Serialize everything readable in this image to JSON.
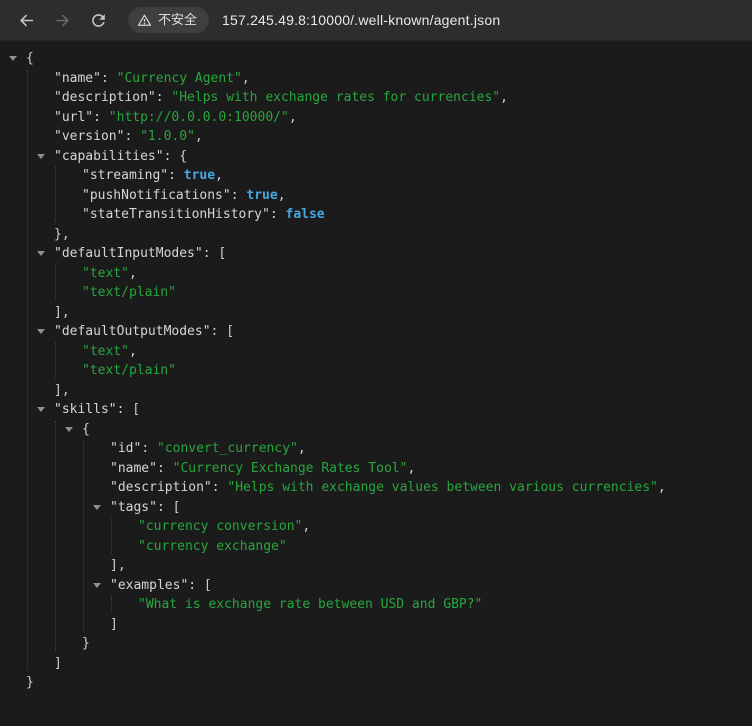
{
  "browser": {
    "security_chip": {
      "label": "不安全",
      "icon": "warning-triangle-icon"
    },
    "url": "157.245.49.8:10000/.well-known/agent.json",
    "icons": {
      "back": "arrow-left",
      "forward": "arrow-right",
      "reload": "refresh"
    }
  },
  "colors": {
    "key": "#d5d5d5",
    "string": "#28a63e",
    "boolean": "#44a7e2",
    "punctuation": "#cfcfcf",
    "guide": "#414141",
    "toolbar_bg": "#2d2d2d",
    "content_bg": "#1b1b1b",
    "chip_bg": "#3f3f3f",
    "icon": "#c6c6c6",
    "icon_disabled": "#696969",
    "url_text": "#e9e9e9",
    "chip_text": "#dedede",
    "triangle": "#8f8f8f"
  },
  "json_viewer": {
    "lines": [
      {
        "level": 0,
        "tri": true,
        "open": true,
        "segs": [
          [
            "p",
            "{"
          ]
        ]
      },
      {
        "level": 1,
        "segs": [
          [
            "k",
            "\"name\""
          ],
          [
            "p",
            ": "
          ],
          [
            "s",
            "\"Currency Agent\""
          ],
          [
            "p",
            ","
          ]
        ]
      },
      {
        "level": 1,
        "segs": [
          [
            "k",
            "\"description\""
          ],
          [
            "p",
            ": "
          ],
          [
            "s",
            "\"Helps with exchange rates for currencies\""
          ],
          [
            "p",
            ","
          ]
        ]
      },
      {
        "level": 1,
        "segs": [
          [
            "k",
            "\"url\""
          ],
          [
            "p",
            ": "
          ],
          [
            "s",
            "\"http://0.0.0.0:10000/\""
          ],
          [
            "p",
            ","
          ]
        ]
      },
      {
        "level": 1,
        "segs": [
          [
            "k",
            "\"version\""
          ],
          [
            "p",
            ": "
          ],
          [
            "s",
            "\"1.0.0\""
          ],
          [
            "p",
            ","
          ]
        ]
      },
      {
        "level": 1,
        "tri": true,
        "open": true,
        "segs": [
          [
            "k",
            "\"capabilities\""
          ],
          [
            "p",
            ": {"
          ]
        ]
      },
      {
        "level": 2,
        "segs": [
          [
            "k",
            "\"streaming\""
          ],
          [
            "p",
            ": "
          ],
          [
            "b",
            "true"
          ],
          [
            "p",
            ","
          ]
        ]
      },
      {
        "level": 2,
        "segs": [
          [
            "k",
            "\"pushNotifications\""
          ],
          [
            "p",
            ": "
          ],
          [
            "b",
            "true"
          ],
          [
            "p",
            ","
          ]
        ]
      },
      {
        "level": 2,
        "segs": [
          [
            "k",
            "\"stateTransitionHistory\""
          ],
          [
            "p",
            ": "
          ],
          [
            "b",
            "false"
          ]
        ]
      },
      {
        "level": 1,
        "close": true,
        "segs": [
          [
            "p",
            "},"
          ]
        ]
      },
      {
        "level": 1,
        "tri": true,
        "open": true,
        "segs": [
          [
            "k",
            "\"defaultInputModes\""
          ],
          [
            "p",
            ": ["
          ]
        ]
      },
      {
        "level": 2,
        "segs": [
          [
            "s",
            "\"text\""
          ],
          [
            "p",
            ","
          ]
        ]
      },
      {
        "level": 2,
        "segs": [
          [
            "s",
            "\"text/plain\""
          ]
        ]
      },
      {
        "level": 1,
        "close": true,
        "segs": [
          [
            "p",
            "],"
          ]
        ]
      },
      {
        "level": 1,
        "tri": true,
        "open": true,
        "segs": [
          [
            "k",
            "\"defaultOutputModes\""
          ],
          [
            "p",
            ": ["
          ]
        ]
      },
      {
        "level": 2,
        "segs": [
          [
            "s",
            "\"text\""
          ],
          [
            "p",
            ","
          ]
        ]
      },
      {
        "level": 2,
        "segs": [
          [
            "s",
            "\"text/plain\""
          ]
        ]
      },
      {
        "level": 1,
        "close": true,
        "segs": [
          [
            "p",
            "],"
          ]
        ]
      },
      {
        "level": 1,
        "tri": true,
        "open": true,
        "segs": [
          [
            "k",
            "\"skills\""
          ],
          [
            "p",
            ": ["
          ]
        ]
      },
      {
        "level": 2,
        "tri": true,
        "open": true,
        "segs": [
          [
            "p",
            "{"
          ]
        ]
      },
      {
        "level": 3,
        "segs": [
          [
            "k",
            "\"id\""
          ],
          [
            "p",
            ": "
          ],
          [
            "s",
            "\"convert_currency\""
          ],
          [
            "p",
            ","
          ]
        ]
      },
      {
        "level": 3,
        "segs": [
          [
            "k",
            "\"name\""
          ],
          [
            "p",
            ": "
          ],
          [
            "s",
            "\"Currency Exchange Rates Tool\""
          ],
          [
            "p",
            ","
          ]
        ]
      },
      {
        "level": 3,
        "segs": [
          [
            "k",
            "\"description\""
          ],
          [
            "p",
            ": "
          ],
          [
            "s",
            "\"Helps with exchange values between various currencies\""
          ],
          [
            "p",
            ","
          ]
        ]
      },
      {
        "level": 3,
        "tri": true,
        "open": true,
        "segs": [
          [
            "k",
            "\"tags\""
          ],
          [
            "p",
            ": ["
          ]
        ]
      },
      {
        "level": 4,
        "segs": [
          [
            "s",
            "\"currency conversion\""
          ],
          [
            "p",
            ","
          ]
        ]
      },
      {
        "level": 4,
        "segs": [
          [
            "s",
            "\"currency exchange\""
          ]
        ]
      },
      {
        "level": 3,
        "close": true,
        "segs": [
          [
            "p",
            "],"
          ]
        ]
      },
      {
        "level": 3,
        "tri": true,
        "open": true,
        "segs": [
          [
            "k",
            "\"examples\""
          ],
          [
            "p",
            ": ["
          ]
        ]
      },
      {
        "level": 4,
        "segs": [
          [
            "s",
            "\"What is exchange rate between USD and GBP?\""
          ]
        ]
      },
      {
        "level": 3,
        "close": true,
        "segs": [
          [
            "p",
            "]"
          ]
        ]
      },
      {
        "level": 2,
        "close": true,
        "segs": [
          [
            "p",
            "}"
          ]
        ]
      },
      {
        "level": 1,
        "close": true,
        "segs": [
          [
            "p",
            "]"
          ]
        ]
      },
      {
        "level": 0,
        "close": true,
        "segs": [
          [
            "p",
            "}"
          ]
        ]
      }
    ]
  }
}
